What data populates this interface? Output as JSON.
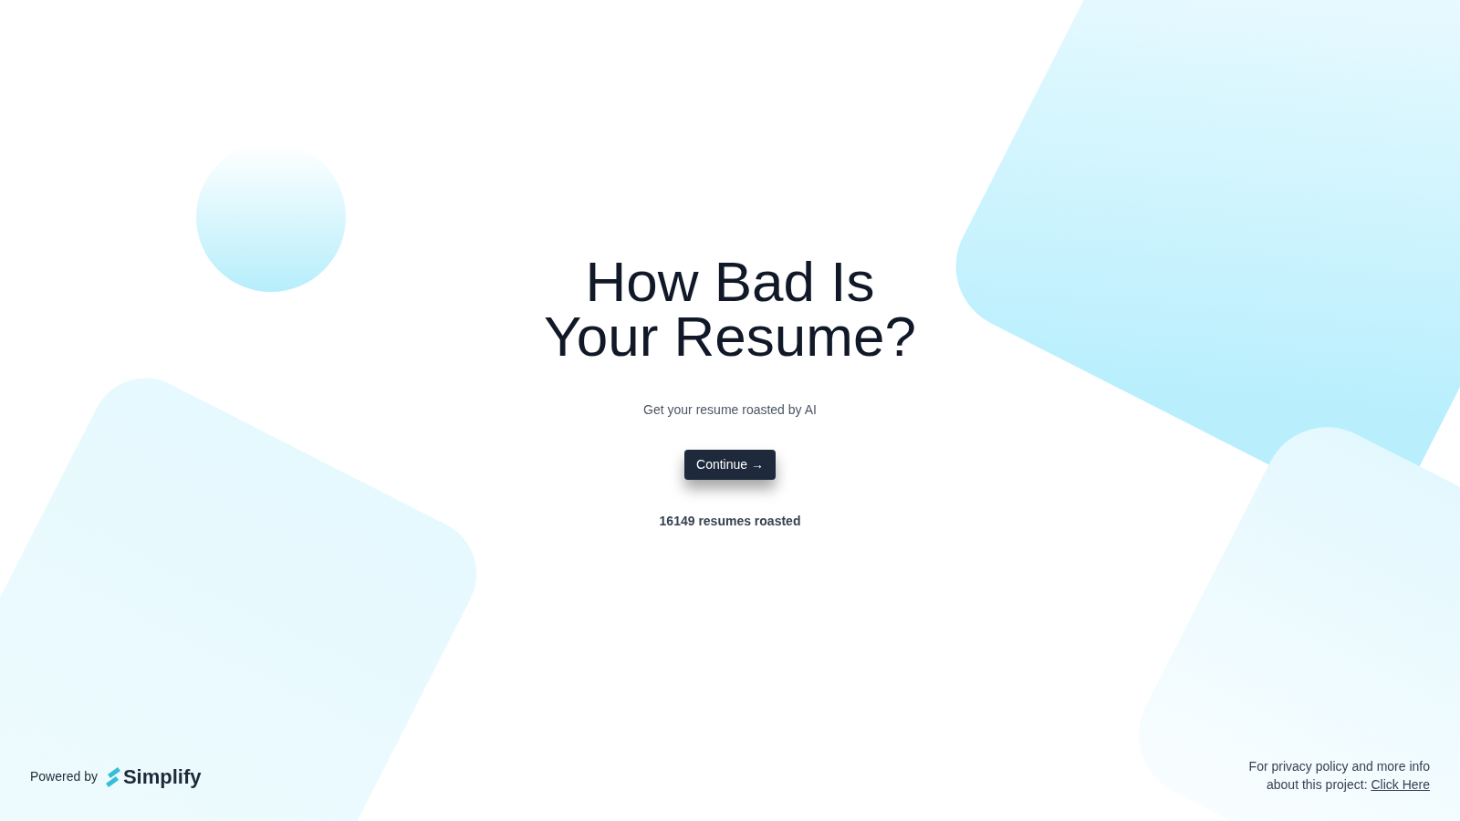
{
  "hero": {
    "title_lines": [
      "How Bad Is",
      "Your Resume?"
    ],
    "subtitle": "Get your resume roasted by AI",
    "button": "Continue →",
    "counter": "16149 resumes roasted"
  },
  "footer": {
    "powered_by": "Powered by",
    "brand": "Simplify",
    "privacy_text": "For privacy policy and more info about this project:",
    "privacy_link": "Click Here"
  }
}
